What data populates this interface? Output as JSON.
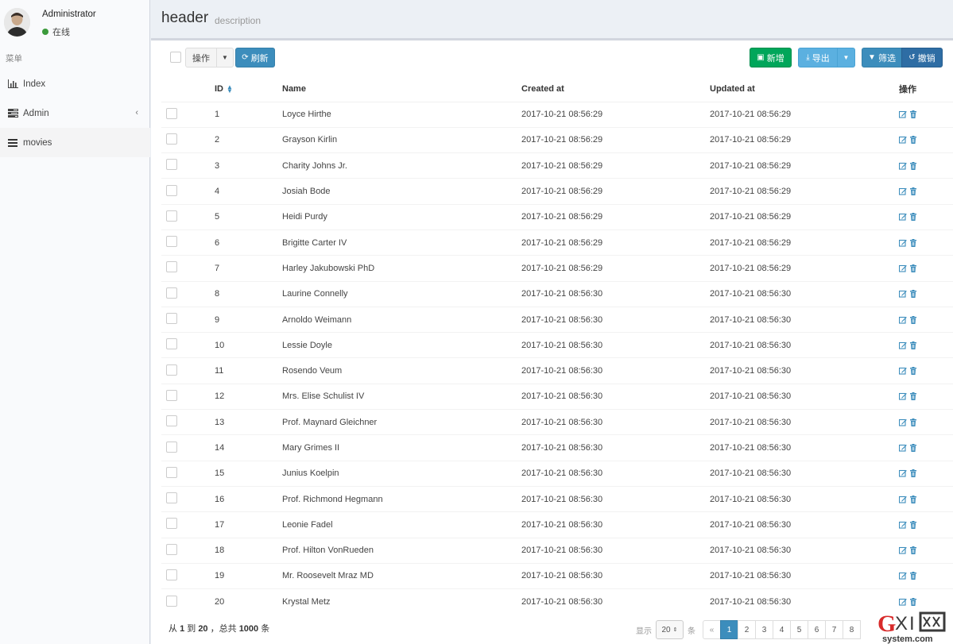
{
  "user": {
    "name": "Administrator",
    "status": "在线"
  },
  "menu": {
    "header": "菜单",
    "items": [
      {
        "label": "Index",
        "icon": "bar-chart-icon",
        "active": false
      },
      {
        "label": "Admin",
        "icon": "tasks-icon",
        "active": false,
        "chevron": "‹"
      },
      {
        "label": "movies",
        "icon": "bars-icon",
        "active": true
      }
    ]
  },
  "header": {
    "title": "header",
    "description": "description"
  },
  "toolbar": {
    "actions_label": "操作",
    "refresh_label": "刷新",
    "new_label": "新增",
    "export_label": "导出",
    "filter_label": "筛选",
    "reset_label": "撤销"
  },
  "table": {
    "columns": [
      "ID",
      "Name",
      "Created at",
      "Updated at",
      "操作"
    ],
    "rows": [
      {
        "id": "1",
        "name": "Loyce Hirthe",
        "created": "2017-10-21 08:56:29",
        "updated": "2017-10-21 08:56:29"
      },
      {
        "id": "2",
        "name": "Grayson Kirlin",
        "created": "2017-10-21 08:56:29",
        "updated": "2017-10-21 08:56:29"
      },
      {
        "id": "3",
        "name": "Charity Johns Jr.",
        "created": "2017-10-21 08:56:29",
        "updated": "2017-10-21 08:56:29"
      },
      {
        "id": "4",
        "name": "Josiah Bode",
        "created": "2017-10-21 08:56:29",
        "updated": "2017-10-21 08:56:29"
      },
      {
        "id": "5",
        "name": "Heidi Purdy",
        "created": "2017-10-21 08:56:29",
        "updated": "2017-10-21 08:56:29"
      },
      {
        "id": "6",
        "name": "Brigitte Carter IV",
        "created": "2017-10-21 08:56:29",
        "updated": "2017-10-21 08:56:29"
      },
      {
        "id": "7",
        "name": "Harley Jakubowski PhD",
        "created": "2017-10-21 08:56:29",
        "updated": "2017-10-21 08:56:29"
      },
      {
        "id": "8",
        "name": "Laurine Connelly",
        "created": "2017-10-21 08:56:30",
        "updated": "2017-10-21 08:56:30"
      },
      {
        "id": "9",
        "name": "Arnoldo Weimann",
        "created": "2017-10-21 08:56:30",
        "updated": "2017-10-21 08:56:30"
      },
      {
        "id": "10",
        "name": "Lessie Doyle",
        "created": "2017-10-21 08:56:30",
        "updated": "2017-10-21 08:56:30"
      },
      {
        "id": "11",
        "name": "Rosendo Veum",
        "created": "2017-10-21 08:56:30",
        "updated": "2017-10-21 08:56:30"
      },
      {
        "id": "12",
        "name": "Mrs. Elise Schulist IV",
        "created": "2017-10-21 08:56:30",
        "updated": "2017-10-21 08:56:30"
      },
      {
        "id": "13",
        "name": "Prof. Maynard Gleichner",
        "created": "2017-10-21 08:56:30",
        "updated": "2017-10-21 08:56:30"
      },
      {
        "id": "14",
        "name": "Mary Grimes II",
        "created": "2017-10-21 08:56:30",
        "updated": "2017-10-21 08:56:30"
      },
      {
        "id": "15",
        "name": "Junius Koelpin",
        "created": "2017-10-21 08:56:30",
        "updated": "2017-10-21 08:56:30"
      },
      {
        "id": "16",
        "name": "Prof. Richmond Hegmann",
        "created": "2017-10-21 08:56:30",
        "updated": "2017-10-21 08:56:30"
      },
      {
        "id": "17",
        "name": "Leonie Fadel",
        "created": "2017-10-21 08:56:30",
        "updated": "2017-10-21 08:56:30"
      },
      {
        "id": "18",
        "name": "Prof. Hilton VonRueden",
        "created": "2017-10-21 08:56:30",
        "updated": "2017-10-21 08:56:30"
      },
      {
        "id": "19",
        "name": "Mr. Roosevelt Mraz MD",
        "created": "2017-10-21 08:56:30",
        "updated": "2017-10-21 08:56:30"
      },
      {
        "id": "20",
        "name": "Krystal Metz",
        "created": "2017-10-21 08:56:30",
        "updated": "2017-10-21 08:56:30"
      }
    ]
  },
  "footer": {
    "from_prefix": "从",
    "from": "1",
    "to_word": "到",
    "to": "20",
    "total_prefix": "，总共",
    "total": "1000",
    "unit": "条",
    "show_label": "显示",
    "per_page": "20",
    "per_page_unit": "条",
    "pages": [
      "«",
      "1",
      "2",
      "3",
      "4",
      "5",
      "6",
      "7",
      "8"
    ],
    "current_page": "1"
  },
  "watermark": {
    "text_top": "GXI网",
    "text_bottom": "system.com"
  },
  "colors": {
    "primary": "#3c8dbc",
    "success": "#00a65a",
    "info": "#5bb0e0",
    "status_online": "#3c9a3c"
  }
}
